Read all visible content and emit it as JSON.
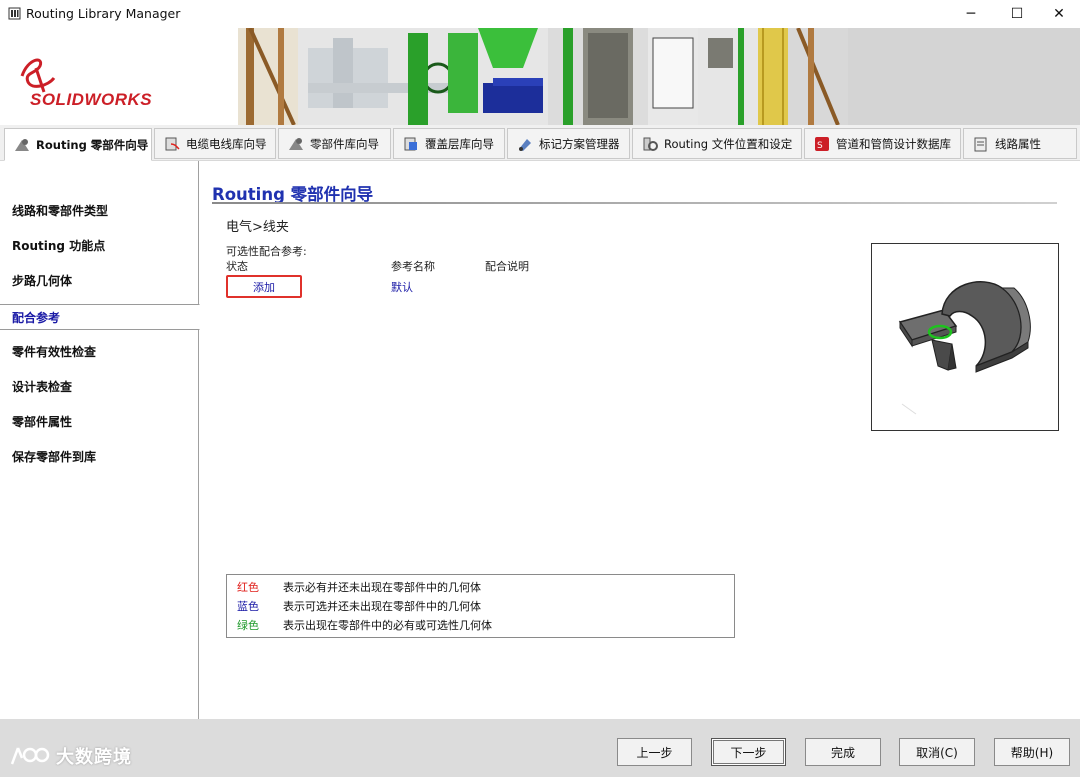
{
  "window": {
    "title": "Routing Library Manager",
    "minimize": "─",
    "maximize": "☐",
    "close": "✕"
  },
  "logo": {
    "text_solid": "SOLID",
    "text_works": "WORKS"
  },
  "tabs": [
    {
      "label": "Routing 零部件向导",
      "icon": "routing-wizard-icon",
      "active": true
    },
    {
      "label": "电缆电线库向导",
      "icon": "cable-library-icon",
      "active": false
    },
    {
      "label": "零部件库向导",
      "icon": "component-library-icon",
      "active": false
    },
    {
      "label": "覆盖层库向导",
      "icon": "covering-library-icon",
      "active": false
    },
    {
      "label": "标记方案管理器",
      "icon": "marking-scheme-icon",
      "active": false
    },
    {
      "label": "Routing 文件位置和设定",
      "icon": "file-locations-icon",
      "active": false
    },
    {
      "label": "管道和管筒设计数据库",
      "icon": "piping-database-icon",
      "active": false
    },
    {
      "label": "线路属性",
      "icon": "route-properties-icon",
      "active": false
    }
  ],
  "sidebar": {
    "items": [
      {
        "label": "线路和零部件类型",
        "active": false
      },
      {
        "label": "Routing 功能点",
        "active": false
      },
      {
        "label": "步路几何体",
        "active": false
      },
      {
        "label": "配合参考",
        "active": true
      },
      {
        "label": "零件有效性检查",
        "active": false
      },
      {
        "label": "设计表检查",
        "active": false
      },
      {
        "label": "零部件属性",
        "active": false
      },
      {
        "label": "保存零部件到库",
        "active": false
      }
    ]
  },
  "main": {
    "title": "Routing 零部件向导",
    "breadcrumb": "电气>线夹",
    "optional_mate_refs_label": "可选性配合参考:",
    "col_status": "状态",
    "col_ref_name": "参考名称",
    "col_mate_desc": "配合说明",
    "add_button": "添加",
    "ref_default": "默认"
  },
  "legend": {
    "rows": [
      {
        "color_name": "红色",
        "color": "#e0201c",
        "desc": "表示必有并还未出现在零部件中的几何体"
      },
      {
        "color_name": "蓝色",
        "color": "#1a1aa6",
        "desc": "表示可选并还未出现在零部件中的几何体"
      },
      {
        "color_name": "绿色",
        "color": "#1e9a2a",
        "desc": "表示出现在零部件中的必有或可选性几何体"
      }
    ]
  },
  "footer": {
    "watermark": "大数跨境",
    "prev": "上一步",
    "next": "下一步",
    "finish": "完成",
    "cancel": "取消(C)",
    "help": "帮助(H)"
  }
}
